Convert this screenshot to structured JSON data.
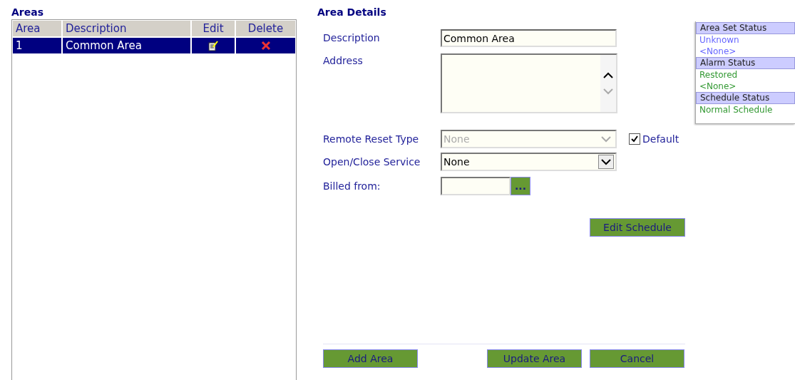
{
  "areas": {
    "title": "Areas",
    "columns": [
      "Area",
      "Description",
      "Edit",
      "Delete"
    ],
    "rows": [
      {
        "area": "1",
        "description": "Common Area",
        "selected": true
      }
    ]
  },
  "details": {
    "title": "Area Details",
    "description": {
      "label": "Description",
      "value": "Common Area"
    },
    "address": {
      "label": "Address"
    },
    "remote_reset": {
      "label": "Remote Reset Type",
      "value": "None",
      "disabled": true,
      "default_label": "Default",
      "default_checked": true
    },
    "open_close": {
      "label": "Open/Close Service",
      "value": "None",
      "disabled": false
    },
    "billed_from": {
      "label": "Billed from:",
      "button": "..."
    },
    "edit_schedule": "Edit Schedule",
    "buttons": [
      "Add Area",
      "Update Area",
      "Cancel"
    ]
  },
  "status": [
    {
      "title": "Area Set Status",
      "color": "#6666ff",
      "values": [
        "Unknown",
        "<None>"
      ]
    },
    {
      "title": "Alarm Status",
      "color": "#339933",
      "values": [
        "Restored",
        "<None>"
      ]
    },
    {
      "title": "Schedule Status",
      "color": "#339933",
      "values": [
        "Normal Schedule"
      ]
    }
  ]
}
